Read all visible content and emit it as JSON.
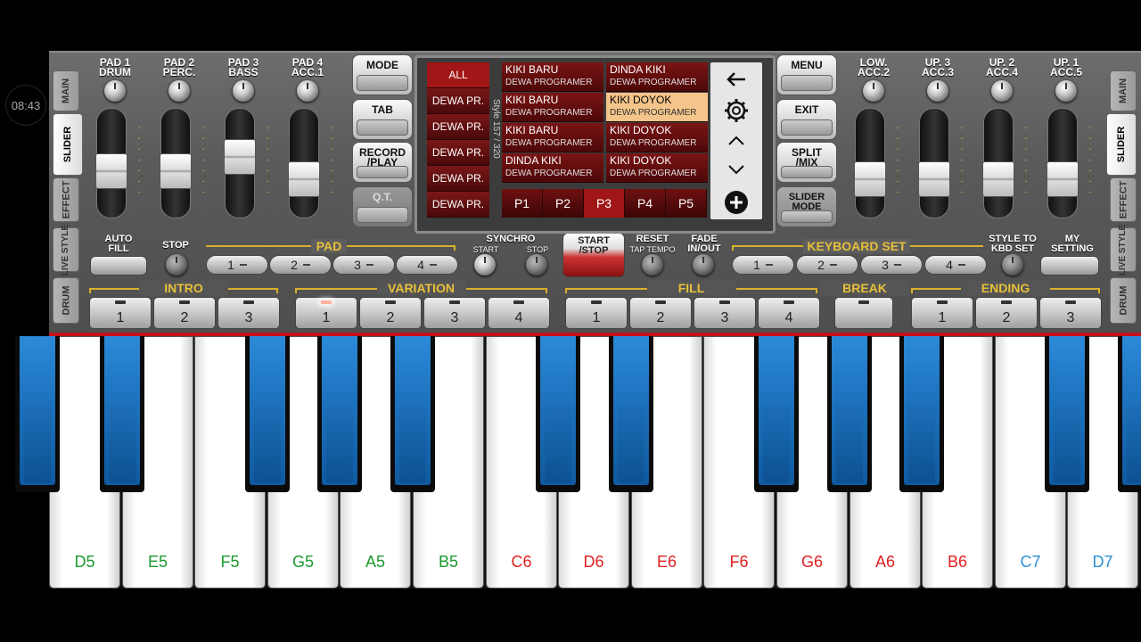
{
  "status": {
    "time": "08:43"
  },
  "side_tabs_left": [
    "MAIN",
    "SLIDER",
    "EFFECT",
    "LIVE STYLE",
    "DRUM"
  ],
  "side_tabs_right": [
    "MAIN",
    "SLIDER",
    "EFFECT",
    "LIVE STYLE",
    "DRUM"
  ],
  "active_side_tab": "SLIDER",
  "pads_left": [
    {
      "line1": "PAD 1",
      "line2": "DRUM",
      "level": 0.4
    },
    {
      "line1": "PAD 2",
      "line2": "PERC.",
      "level": 0.4
    },
    {
      "line1": "PAD 3",
      "line2": "BASS",
      "level": 0.6
    },
    {
      "line1": "PAD 4",
      "line2": "ACC.1",
      "level": 0.3
    }
  ],
  "pads_right": [
    {
      "line1": "LOW.",
      "line2": "ACC.2",
      "level": 0.3
    },
    {
      "line1": "UP. 3",
      "line2": "ACC.3",
      "level": 0.3
    },
    {
      "line1": "UP. 2",
      "line2": "ACC.4",
      "level": 0.3
    },
    {
      "line1": "UP. 1",
      "line2": "ACC.5",
      "level": 0.3
    }
  ],
  "left_menu": [
    {
      "line1": "MODE",
      "line2": ""
    },
    {
      "line1": "TAB",
      "line2": ""
    },
    {
      "line1": "RECORD",
      "line2": "/PLAY"
    },
    {
      "line1": "Q.T.",
      "line2": ""
    }
  ],
  "right_menu": [
    {
      "line1": "MENU",
      "line2": ""
    },
    {
      "line1": "EXIT",
      "line2": ""
    },
    {
      "line1": "SPLIT",
      "line2": "/MIX"
    },
    {
      "line1": "SLIDER",
      "line2": "MODE"
    }
  ],
  "lcd": {
    "categories": [
      "ALL",
      "DEWA PR.",
      "DEWA PR.",
      "DEWA PR.",
      "DEWA PR.",
      "DEWA PR."
    ],
    "selected_category": 0,
    "vertical_label": "Style 157 / 320",
    "styles": [
      {
        "name": "KIKI BARU",
        "author": "DEWA PROGRAMER"
      },
      {
        "name": "DINDA KIKI",
        "author": "DEWA PROGRAMER"
      },
      {
        "name": "KIKI BARU",
        "author": "DEWA PROGRAMER"
      },
      {
        "name": "KIKI DOYOK",
        "author": "DEWA PROGRAMER"
      },
      {
        "name": "KIKI BARU",
        "author": "DEWA PROGRAMER"
      },
      {
        "name": "KIKI DOYOK",
        "author": "DEWA PROGRAMER"
      },
      {
        "name": "DINDA KIKI",
        "author": "DEWA PROGRAMER"
      },
      {
        "name": "KIKI DOYOK",
        "author": "DEWA PROGRAMER"
      }
    ],
    "selected_style": 3,
    "pages": [
      "P1",
      "P2",
      "P3",
      "P4",
      "P5"
    ],
    "selected_page": 2,
    "side_icons": [
      "back-arrow-icon",
      "gear-icon",
      "chevron-up-icon",
      "chevron-down-icon",
      "plus-icon"
    ]
  },
  "row2": {
    "auto_fill": "AUTO FILL",
    "stop": "STOP",
    "pad_group": "PAD",
    "pad_buttons": [
      "1",
      "2",
      "3",
      "4"
    ],
    "synchro": "SYNCHRO",
    "synchro_start": "START",
    "synchro_stop": "STOP",
    "start_stop": "START /STOP",
    "reset": "RESET",
    "tap_tempo": "TAP TEMPO",
    "fade": "FADE IN/OUT",
    "keyboard_set": "KEYBOARD SET",
    "kbd_buttons": [
      "1",
      "2",
      "3",
      "4"
    ],
    "style_to_kbd": "STYLE TO KBD SET",
    "my_setting": "MY SETTING"
  },
  "row3": {
    "intro": {
      "label": "INTRO",
      "buttons": [
        "1",
        "2",
        "3"
      ]
    },
    "variation": {
      "label": "VARIATION",
      "buttons": [
        "1",
        "2",
        "3",
        "4"
      ],
      "active": 0
    },
    "fill": {
      "label": "FILL",
      "buttons": [
        "1",
        "2",
        "3",
        "4"
      ]
    },
    "break": {
      "label": "BREAK"
    },
    "ending": {
      "label": "ENDING",
      "buttons": [
        "1",
        "2",
        "3"
      ]
    }
  },
  "keyboard": {
    "white_keys": [
      {
        "note": "D5",
        "color": "#1a9a2e"
      },
      {
        "note": "E5",
        "color": "#1a9a2e"
      },
      {
        "note": "F5",
        "color": "#1a9a2e"
      },
      {
        "note": "G5",
        "color": "#1a9a2e"
      },
      {
        "note": "A5",
        "color": "#1a9a2e"
      },
      {
        "note": "B5",
        "color": "#1a9a2e"
      },
      {
        "note": "C6",
        "color": "#e02020"
      },
      {
        "note": "D6",
        "color": "#e02020"
      },
      {
        "note": "E6",
        "color": "#e02020"
      },
      {
        "note": "F6",
        "color": "#e02020"
      },
      {
        "note": "G6",
        "color": "#e02020"
      },
      {
        "note": "A6",
        "color": "#e02020"
      },
      {
        "note": "B6",
        "color": "#e02020"
      },
      {
        "note": "C7",
        "color": "#2a90d0"
      },
      {
        "note": "D7",
        "color": "#2a90d0"
      }
    ]
  }
}
